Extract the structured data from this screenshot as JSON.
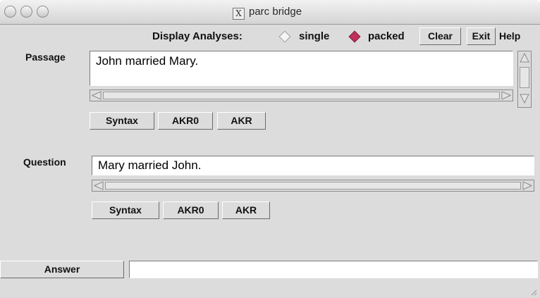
{
  "window": {
    "title": "parc bridge"
  },
  "toolbar": {
    "display_label": "Display Analyses:",
    "mode_options": [
      {
        "label": "single",
        "selected": false
      },
      {
        "label": "packed",
        "selected": true
      }
    ],
    "clear_label": "Clear",
    "exit_label": "Exit",
    "help_label": "Help"
  },
  "passage": {
    "label": "Passage",
    "value": "John married Mary.",
    "buttons": [
      "Syntax",
      "AKR0",
      "AKR"
    ]
  },
  "question": {
    "label": "Question",
    "value": "Mary married John.",
    "buttons": [
      "Syntax",
      "AKR0",
      "AKR"
    ]
  },
  "answer": {
    "label": "Answer",
    "value": ""
  },
  "colors": {
    "selected_radio": "#c0305a",
    "window_bg": "#dcdcdc"
  }
}
